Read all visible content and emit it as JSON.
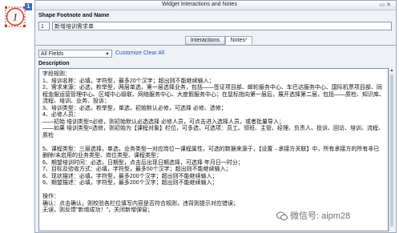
{
  "shape": {
    "number": "1",
    "badge": "1"
  },
  "window": {
    "title": "Widget Interactions and Notes"
  },
  "footnote": {
    "label": "Shape Footnote and Name",
    "number": "1",
    "name": "新增培训需求单"
  },
  "tabs": [
    {
      "label": "Interactions",
      "active": false
    },
    {
      "label": "Notes",
      "active": true,
      "marker": "*"
    }
  ],
  "filter": {
    "selected": "All Fields",
    "customize_label": "Customize",
    "clear_label": "Clear All"
  },
  "description": {
    "label": "Description",
    "text": "字段规则：\n1、培训名称：必填，字符型，最多20个汉字；超出则不能继续输入；\n2、需求来源：必选，枚举型，两层单选，第一层选择业务，包括——签证项目部、邮轮服务中心、车巴达服务中心、国际机票项目部、同程金服运营管理中心、区域中心级联、网络服务中心、大度假服务中心；在鼠标指向第一层后，展开选择第二层，包括——质检、知识库、流程、培训、业务、投诉；\n3、培训类型：必选，枚举型，单选，初始默认必修，可选择 必修、选修；\n4、必修人员：\n——初始 培训类型=必修，则初始默认必选选择 必修人员，可点击进入选择人员，或者批量导入；\n——如果 培训类型=选修，则初始为【课程对象】栏位，可多选，可选项：员工、领班、主管、经理、负责人、投诉、回访、培训、流程、质检\n\n5、课程类型：三层选择，单选，业务类型一对应岗位一课程属性，可选的数据来源于，【设置→承接方关联】中，所有承接方的所有非已删除/未启用的业务类型、岗位类型、课程类型；\n6、期望培训时间：必选，日期型，点击后出现日期选择，可选择 年月日一时分；\n7、目标及验收方式：必填，字符型，最多50个汉字；超出则不能继续输入；\n8、现状描述：必填，字符型，最多200个汉字；超出则不能继续输入；\n9、期望描述：必填，字符型，最多200个汉字；超出则不能继续输入；\n\n操作：\n确认：点击确认，则校验各栏位填写内容是否符合规则，违背则提示对应错误；\n无误，则反馈\"新增成功！\"，关闭新增弹窗；"
  },
  "watermark": {
    "text": "微信号: aipm28"
  }
}
